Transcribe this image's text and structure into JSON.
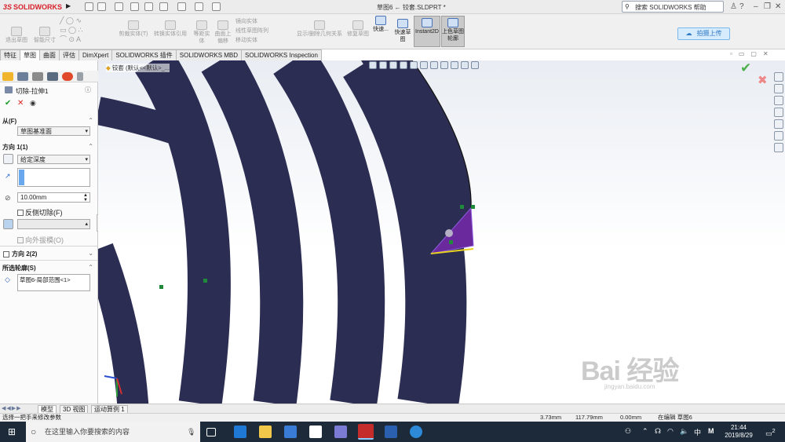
{
  "app": {
    "brand": "SOLIDWORKS",
    "title": "草图6 ← 铰套.SLDPRT *"
  },
  "help_search": {
    "label": "搜索 SOLIDWORKS 帮助"
  },
  "ribbon": {
    "left_group": [
      "退出草图",
      "智能尺寸"
    ],
    "items": [
      "剪裁实体(T)",
      "转换实体引用",
      "等距实体",
      "曲面上偏移",
      "镜向实体",
      "线性草图阵列",
      "移动实体",
      "显示/删除几何关系",
      "修复草图",
      "快速...",
      "快速草图",
      "Instant2D",
      "上色草图轮廓"
    ],
    "upload_btn": "拍摄上传"
  },
  "tabs": [
    "特征",
    "草图",
    "曲面",
    "评估",
    "DimXpert",
    "SOLIDWORKS 插件",
    "SOLIDWORKS MBD",
    "SOLIDWORKS Inspection"
  ],
  "active_tab": "草图",
  "panel": {
    "feature_title": "切除-拉伸1",
    "from_label": "从(F)",
    "from_value": "草图基准面",
    "direction1_label": "方向 1(1)",
    "direction1_type": "给定深度",
    "depth_value": "10.00mm",
    "reverse_cut": "反侧切除(F)",
    "draft_outward": "向外拔模(O)",
    "direction2_label": "方向 2(2)",
    "contours_label": "所选轮廓(S)",
    "contour_item": "草图6-局部范围<1>"
  },
  "viewport": {
    "tree_crumb": "铰套 (默认<<默认>_..."
  },
  "bottom_tabs": [
    "模型",
    "3D 视图",
    "运动算例 1"
  ],
  "status": {
    "hint": "选择一把手来修改参数",
    "coord1": "3.73mm",
    "coord2": "117.79mm",
    "coord3": "0.00mm",
    "state": "在编辑 草图6"
  },
  "taskbar": {
    "search_placeholder": "在这里输入你要搜索的内容",
    "time": "21:44",
    "date": "2019/8/29",
    "ime": "中",
    "notifications": "2"
  },
  "watermark": {
    "text": "Bai 经验",
    "sub": "jingyan.baidu.com"
  },
  "colors": {
    "part": "#2c2d52",
    "accent_red": "#d8202a",
    "selection": "#6a2a9e",
    "point_green": "#1f8a3a"
  }
}
